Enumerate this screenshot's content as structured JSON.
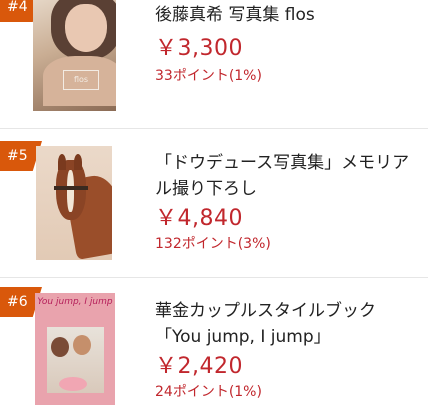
{
  "items": [
    {
      "rank": "#4",
      "title": "後藤真希 写真集 flos",
      "price": "￥3,300",
      "points": "33ポイント(1%)",
      "cover_text": "flos"
    },
    {
      "rank": "#5",
      "title": "「ドウデュース写真集」メモリアル撮り下ろし",
      "price": "￥4,840",
      "points": "132ポイント(3%)"
    },
    {
      "rank": "#6",
      "title": "華金カップルスタイルブック「You jump, I jump」",
      "price": "￥2,420",
      "points": "24ポイント(1%)",
      "cover_text": "You jump, I jump"
    }
  ],
  "colors": {
    "rank_badge": "#d9580b",
    "price": "#c1272d",
    "divider": "#e6e6e6"
  }
}
